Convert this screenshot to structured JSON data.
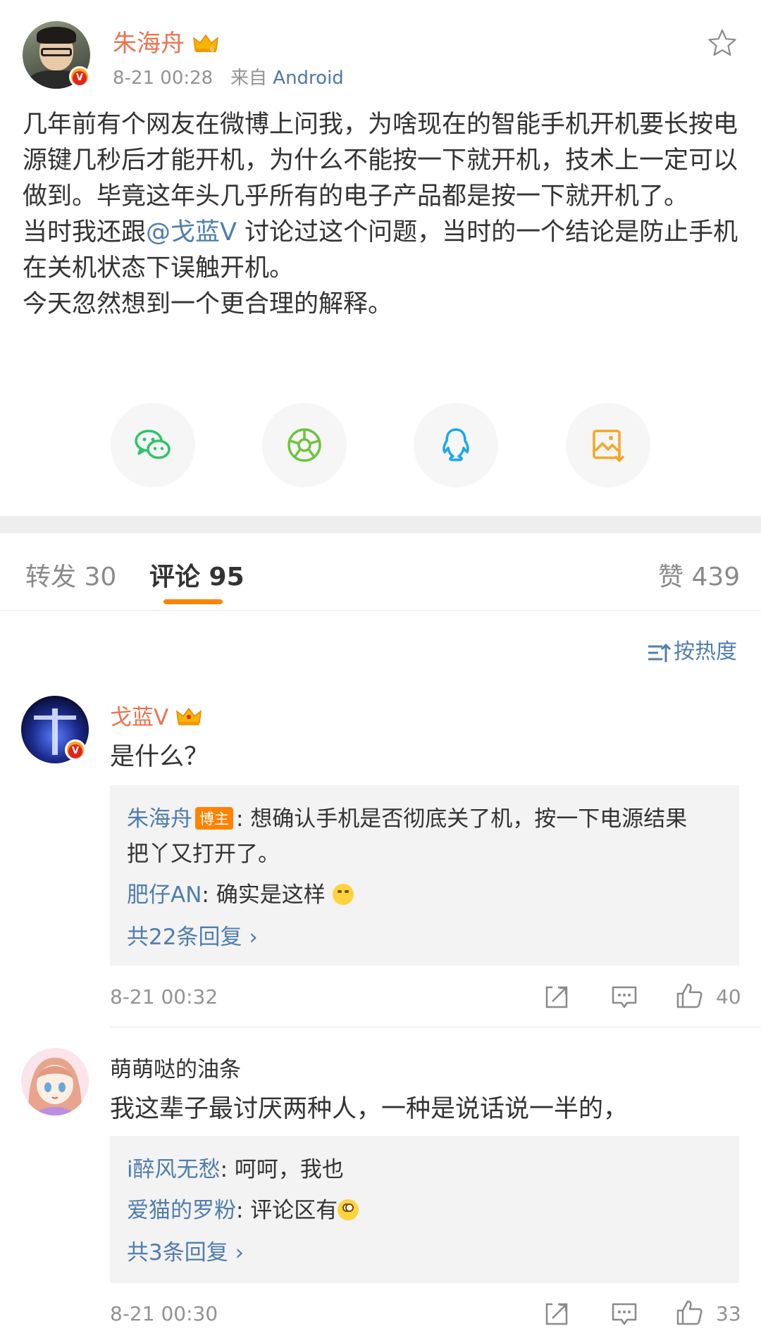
{
  "post": {
    "author": "朱海舟",
    "time": "8-21 00:28",
    "source_prefix": "来自",
    "source": "Android",
    "body_1": "几年前有个网友在微博上问我，为啥现在的智能手机开机要长按电源键几秒后才能开机，为什么不能按一下就开机，技术上一定可以做到。毕竟这年头几乎所有的电子产品都是按一下就开机了。\n当时我还跟",
    "mention": "@戈蓝V",
    "body_2": " 讨论过这个问题，当时的一个结论是防止手机在关机状态下误触开机。\n今天忽然想到一个更合理的解释。",
    "verified_badge": "V"
  },
  "share_icons": [
    "wechat-icon",
    "moments-icon",
    "qq-icon",
    "save-image-icon"
  ],
  "colors": {
    "accent": "#ff8200",
    "link": "#507daf",
    "author": "#eb7350"
  },
  "tabs": {
    "repost": "转发 30",
    "comments": "评论 95",
    "likes": "赞 439"
  },
  "sort_label": "按热度",
  "comments": [
    {
      "name": "戈蓝V",
      "text": "是什么？",
      "replies": [
        {
          "name": "朱海舟",
          "badge": "博主",
          "text": ": 想确认手机是否彻底关了机，按一下电源结果",
          "text_cont": "把丫又打开了。"
        },
        {
          "name": "肥仔AN",
          "text": ": 确实是这样"
        }
      ],
      "more": "共22条回复",
      "time": "8-21 00:32",
      "likes": "40"
    },
    {
      "name": "萌萌哒的油条",
      "text": "我这辈子最讨厌两种人，一种是说话说一半的，",
      "replies": [
        {
          "name": "i醉风无愁",
          "text": ": 呵呵，我也"
        },
        {
          "name": "爱猫的罗粉",
          "text": ": 评论区有"
        }
      ],
      "more": "共3条回复",
      "time": "8-21 00:30",
      "likes": "33"
    }
  ]
}
